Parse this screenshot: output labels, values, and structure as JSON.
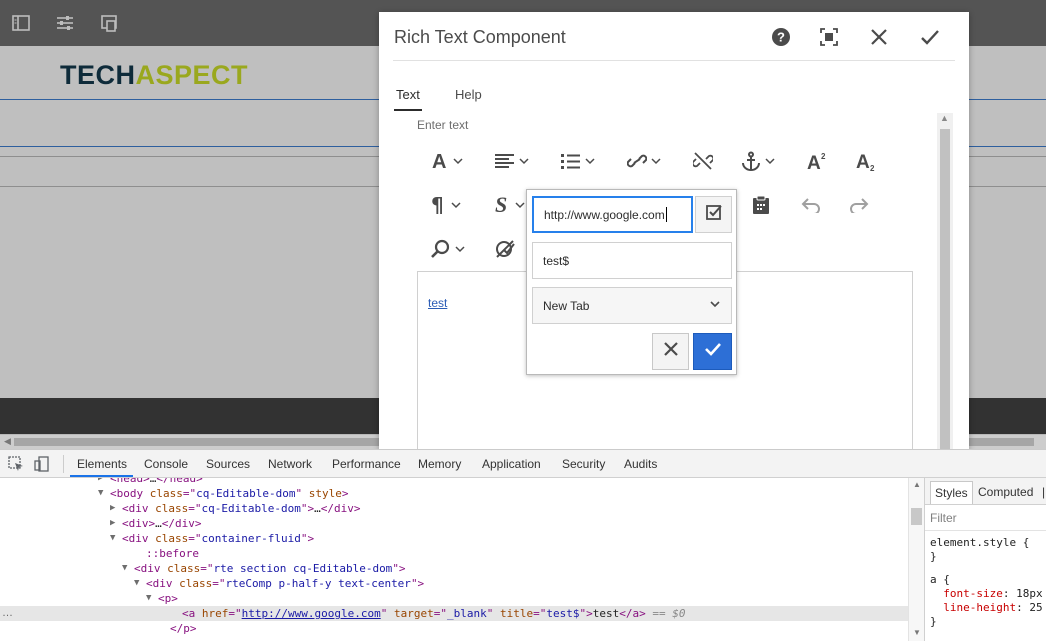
{
  "brand": {
    "logo_part1": "TECH",
    "logo_part2": "ASPECT"
  },
  "dialog": {
    "title": "Rich Text Component",
    "tabs": [
      {
        "label": "Text"
      },
      {
        "label": "Help"
      }
    ],
    "field_label": "Enter text",
    "editor_text": "test"
  },
  "link_popover": {
    "url_value": "http://www.google.com",
    "title_value": "test$",
    "target_value": "New Tab"
  },
  "devtools": {
    "tabs": [
      "Elements",
      "Console",
      "Sources",
      "Network",
      "Performance",
      "Memory",
      "Application",
      "Security",
      "Audits"
    ],
    "dom": [
      {
        "indent": 110,
        "tri": "▶",
        "html": "<span class='tag'>&lt;head&gt;</span><span class='txt'>…</span><span class='tag'>&lt;/head&gt;</span>"
      },
      {
        "indent": 110,
        "tri": "▼",
        "html": "<span class='tag'>&lt;body </span><span class='attr'>class</span><span class='tag'>=\"</span><span class='val'>cq-Editable-dom</span><span class='tag'>\" </span><span class='attr'>style</span><span class='tag'>&gt;</span>"
      },
      {
        "indent": 122,
        "tri": "▶",
        "html": "<span class='tag'>&lt;div </span><span class='attr'>class</span><span class='tag'>=\"</span><span class='val'>cq-Editable-dom</span><span class='tag'>\"&gt;</span><span class='txt'>…</span><span class='tag'>&lt;/div&gt;</span>"
      },
      {
        "indent": 122,
        "tri": "▶",
        "html": "<span class='tag'>&lt;div&gt;</span><span class='txt'>…</span><span class='tag'>&lt;/div&gt;</span>"
      },
      {
        "indent": 122,
        "tri": "▼",
        "html": "<span class='tag'>&lt;div </span><span class='attr'>class</span><span class='tag'>=\"</span><span class='val'>container-fluid</span><span class='tag'>\"&gt;</span>"
      },
      {
        "indent": 146,
        "tri": "",
        "html": "<span class='pseudo'>::before</span>"
      },
      {
        "indent": 134,
        "tri": "▼",
        "html": "<span class='tag'>&lt;div </span><span class='attr'>class</span><span class='tag'>=\"</span><span class='val'>rte section cq-Editable-dom</span><span class='tag'>\"&gt;</span>"
      },
      {
        "indent": 146,
        "tri": "▼",
        "html": "<span class='tag'>&lt;div </span><span class='attr'>class</span><span class='tag'>=\"</span><span class='val'>rteComp p-half-y text-center</span><span class='tag'>\"&gt;</span>"
      },
      {
        "indent": 158,
        "tri": "▼",
        "html": "<span class='tag'>&lt;p&gt;</span>"
      },
      {
        "indent": 182,
        "tri": "",
        "sel": true,
        "html": "<span class='tag'>&lt;a </span><span class='attr'>href</span><span class='tag'>=\"</span><span class='link'>http://www.google.com</span><span class='tag'>\" </span><span class='attr'>target</span><span class='tag'>=\"</span><span class='val'>_blank</span><span class='tag'>\" </span><span class='attr'>title</span><span class='tag'>=\"</span><span class='val'>test$</span><span class='tag'>\"&gt;</span><span class='txt'>test</span><span class='tag'>&lt;/a&gt;</span><span class='eq'> == $0</span>"
      },
      {
        "indent": 170,
        "tri": "",
        "html": "<span class='tag'>&lt;/p&gt;</span>"
      }
    ],
    "styles_tabs": [
      "Styles",
      "Computed"
    ],
    "filter_placeholder": "Filter",
    "styles": [
      {
        "html": "<span class='txt'>element.style {</span>"
      },
      {
        "html": "<span class='txt'>}</span>"
      },
      {
        "html": "<span class='txt'>a {</span>"
      },
      {
        "html": "  <span class='prop'>font-size</span>: 18px"
      },
      {
        "html": "  <span class='prop'>line-height</span>: 25"
      },
      {
        "html": "<span class='txt'>}</span>"
      }
    ]
  },
  "colors": {
    "accent": "#2d6fd6",
    "link": "#2b5cb6",
    "logo_dark": "#0e2b3a",
    "logo_green": "#9aa81e"
  }
}
